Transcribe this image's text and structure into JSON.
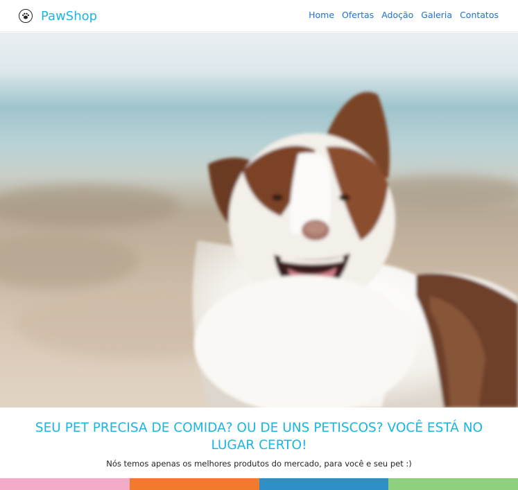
{
  "brand": {
    "name": "PawShop",
    "icon": "paw-icon",
    "color": "#1ab6e2"
  },
  "nav": {
    "items": [
      {
        "label": "Home"
      },
      {
        "label": "Ofertas"
      },
      {
        "label": "Adoção"
      },
      {
        "label": "Galeria"
      },
      {
        "label": "Contatos"
      }
    ],
    "link_color": "#1f6fd1"
  },
  "hero": {
    "subject": "dog-photo"
  },
  "content": {
    "headline": "SEU PET PRECISA DE COMIDA? OU DE UNS PETISCOS? VOCÊ ESTÁ NO LUGAR CERTO!",
    "subtitle": "Nós temos apenas os melhores produtos do mercado, para você e seu pet :)"
  },
  "stripe_colors": [
    "#f3a9c8",
    "#f27a2d",
    "#2e8fc6",
    "#8ed07e"
  ]
}
